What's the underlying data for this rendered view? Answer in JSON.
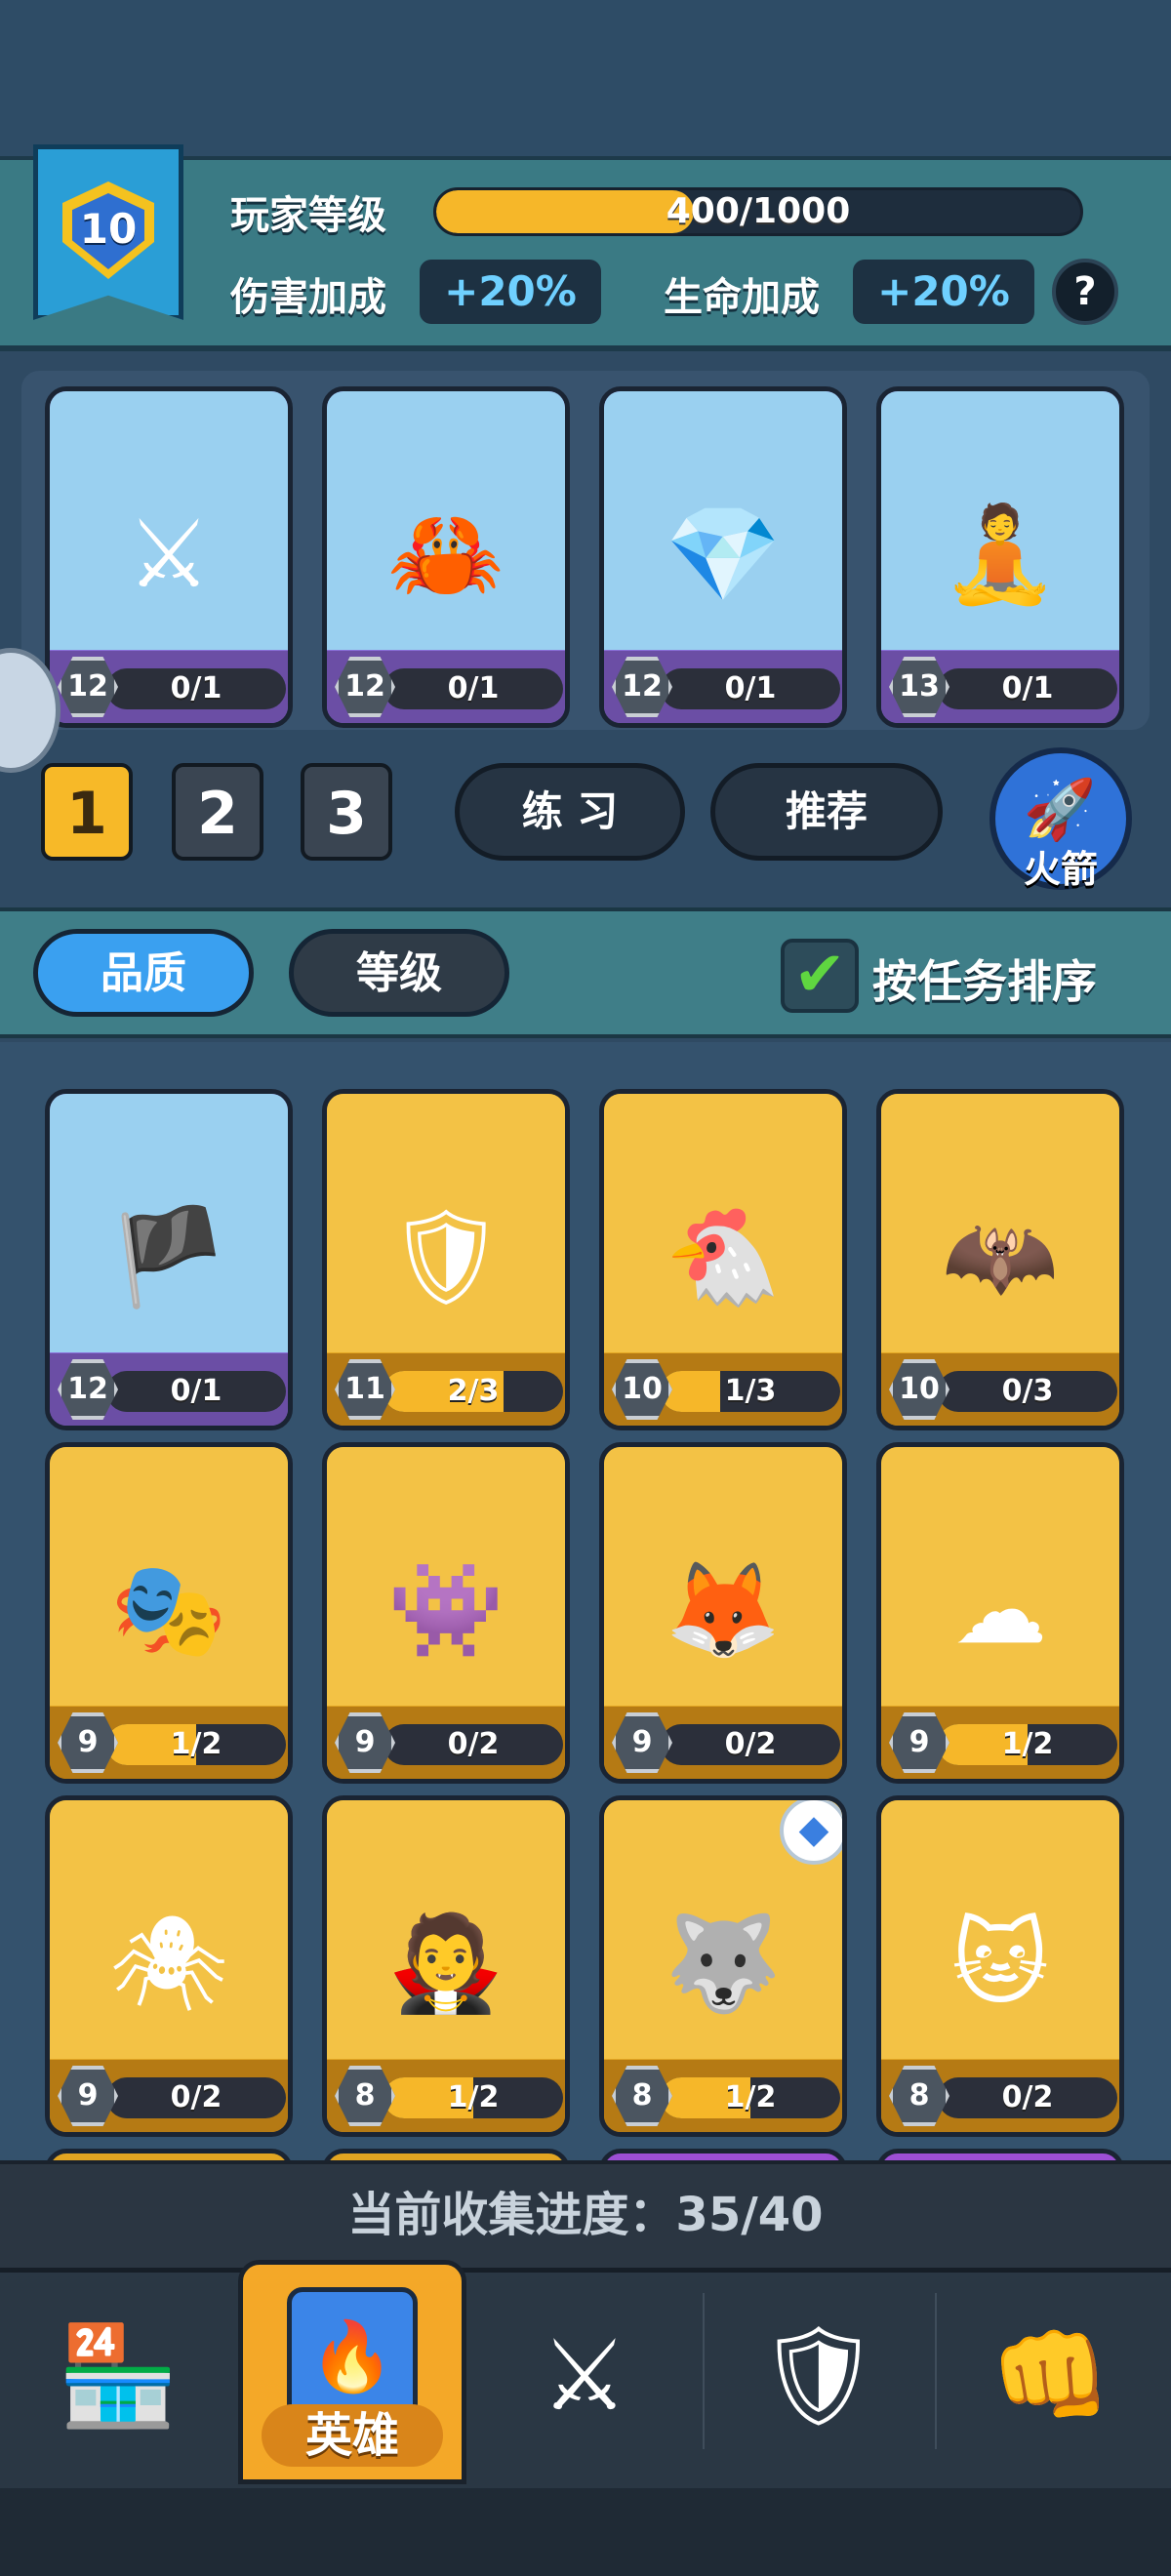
{
  "player": {
    "level": "10",
    "level_label": "玩家等级",
    "xp_text": "400/1000",
    "xp_fraction": 0.4,
    "damage_label": "伤害加成",
    "damage_value": "+20%",
    "health_label": "生命加成",
    "health_value": "+20%",
    "help": "?"
  },
  "deck": [
    {
      "level": "12",
      "progress": "0/1",
      "fill": 0,
      "rarity": "rare",
      "icon": "samurai-hero-icon",
      "glyph": "⚔"
    },
    {
      "level": "12",
      "progress": "0/1",
      "fill": 0,
      "rarity": "rare",
      "icon": "crab-chef-hero-icon",
      "glyph": "🦀"
    },
    {
      "level": "12",
      "progress": "0/1",
      "fill": 0,
      "rarity": "rare",
      "icon": "crystal-knight-hero-icon",
      "glyph": "💎"
    },
    {
      "level": "13",
      "progress": "0/1",
      "fill": 0,
      "rarity": "rare",
      "icon": "monk-hero-icon",
      "glyph": "🧘"
    }
  ],
  "deck_tabs": [
    "1",
    "2",
    "3"
  ],
  "buttons": {
    "practice": "练 习",
    "recommend": "推荐",
    "rocket": "火箭"
  },
  "filters": {
    "quality": "品质",
    "level": "等级",
    "sort_by_task": "按任务排序"
  },
  "heroes": [
    {
      "level": "12",
      "progress": "0/1",
      "fill": 0,
      "rarity": "rare",
      "icon": "pirate-hero-icon",
      "glyph": "🏴"
    },
    {
      "level": "11",
      "progress": "2/3",
      "fill": 0.667,
      "rarity": "gold",
      "icon": "knight-hero-icon",
      "glyph": "🛡"
    },
    {
      "level": "10",
      "progress": "1/3",
      "fill": 0.333,
      "rarity": "gold",
      "icon": "boxing-chicken-hero-icon",
      "glyph": "🐔"
    },
    {
      "level": "10",
      "progress": "0/3",
      "fill": 0,
      "rarity": "gold",
      "icon": "bat-hero-icon",
      "glyph": "🦇"
    },
    {
      "level": "9",
      "progress": "1/2",
      "fill": 0.5,
      "rarity": "gold",
      "icon": "tribal-mask-hero-icon",
      "glyph": "🎭"
    },
    {
      "level": "9",
      "progress": "0/2",
      "fill": 0,
      "rarity": "gold",
      "icon": "shadow-bat-hero-icon",
      "glyph": "👾"
    },
    {
      "level": "9",
      "progress": "0/2",
      "fill": 0,
      "rarity": "gold",
      "icon": "fox-mask-girl-hero-icon",
      "glyph": "🦊"
    },
    {
      "level": "9",
      "progress": "1/2",
      "fill": 0.5,
      "rarity": "gold",
      "icon": "cloud-hero-icon",
      "glyph": "☁"
    },
    {
      "level": "9",
      "progress": "0/2",
      "fill": 0,
      "rarity": "gold",
      "icon": "spider-hero-icon",
      "glyph": "🕷"
    },
    {
      "level": "8",
      "progress": "1/2",
      "fill": 0.5,
      "rarity": "gold",
      "icon": "vampire-maid-hero-icon",
      "glyph": "🧛"
    },
    {
      "level": "8",
      "progress": "1/2",
      "fill": 0.5,
      "rarity": "gold",
      "icon": "wolf-hero-icon",
      "glyph": "🐺",
      "badge": "blue-gem-badge-icon"
    },
    {
      "level": "8",
      "progress": "0/2",
      "fill": 0,
      "rarity": "gold",
      "icon": "pharaoh-cat-hero-icon",
      "glyph": "🐱"
    }
  ],
  "collection": {
    "text": "当前收集进度：35/40"
  },
  "nav": {
    "shop_icon": "shop-icon",
    "heroes_label": "英雄",
    "battle_icon": "crossed-swords-icon",
    "clan_icon": "shield-emblem-icon",
    "gauntlet_icon": "power-fist-icon"
  }
}
